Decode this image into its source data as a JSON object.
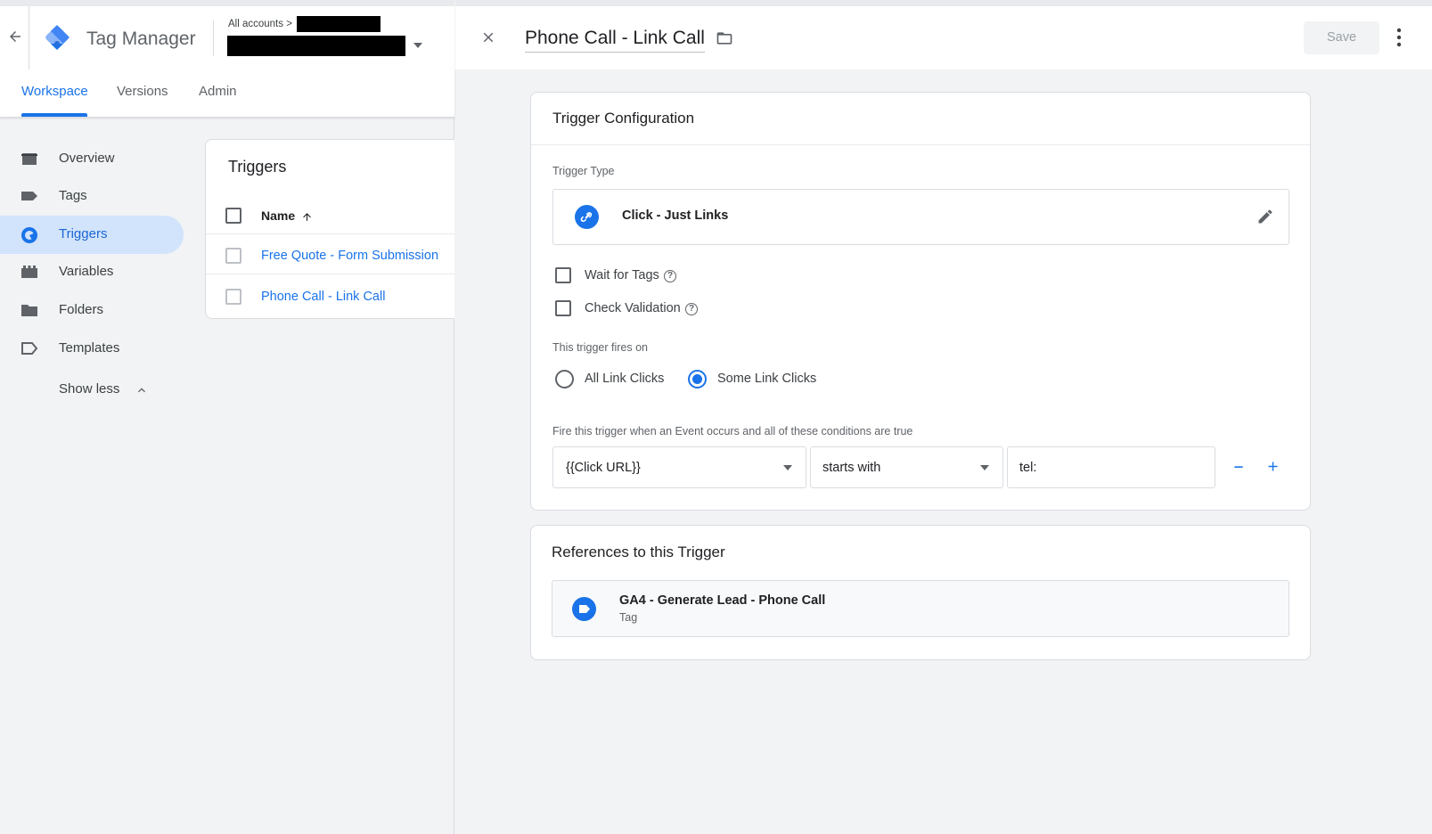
{
  "app": {
    "title": "Tag Manager",
    "accounts_breadcrumb": "All accounts >"
  },
  "tabs": [
    {
      "label": "Workspace",
      "active": true
    },
    {
      "label": "Versions",
      "active": false
    },
    {
      "label": "Admin",
      "active": false
    }
  ],
  "sidebar": {
    "items": [
      {
        "label": "Overview",
        "icon": "briefcase-icon"
      },
      {
        "label": "Tags",
        "icon": "tag-icon"
      },
      {
        "label": "Triggers",
        "icon": "trigger-icon",
        "active": true
      },
      {
        "label": "Variables",
        "icon": "variables-icon"
      },
      {
        "label": "Folders",
        "icon": "folder-icon"
      },
      {
        "label": "Templates",
        "icon": "template-icon"
      }
    ],
    "show_less": "Show less"
  },
  "triggers_list": {
    "title": "Triggers",
    "column_name": "Name",
    "rows": [
      "Free Quote - Form Submission",
      "Phone Call - Link Call"
    ]
  },
  "editor": {
    "title": "Phone Call - Link Call",
    "save_label": "Save"
  },
  "config": {
    "title": "Trigger Configuration",
    "trigger_type_label": "Trigger Type",
    "trigger_type": "Click - Just Links",
    "wait_for_tags": "Wait for Tags",
    "check_validation": "Check Validation",
    "fires_on_label": "This trigger fires on",
    "fires_on_options": [
      "All Link Clicks",
      "Some Link Clicks"
    ],
    "fires_on_selected": "Some Link Clicks",
    "condition_label": "Fire this trigger when an Event occurs and all of these conditions are true",
    "condition": {
      "variable": "{{Click URL}}",
      "operator": "starts with",
      "value": "tel:"
    }
  },
  "references": {
    "title": "References to this Trigger",
    "items": [
      {
        "name": "GA4 - Generate Lead - Phone Call",
        "type": "Tag"
      }
    ]
  },
  "colors": {
    "accent": "#1a73e8",
    "active_nav_bg": "#d2e3fc",
    "background": "#f1f3f4"
  }
}
